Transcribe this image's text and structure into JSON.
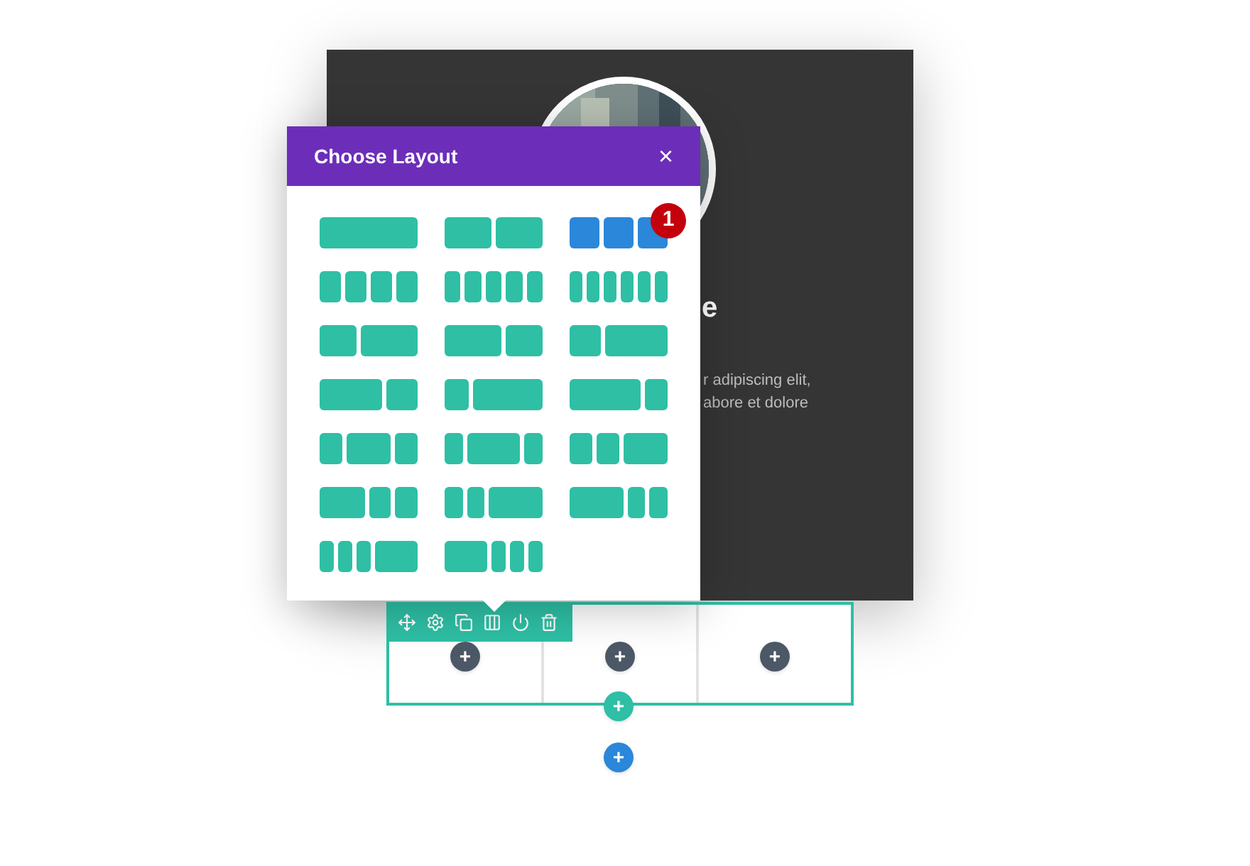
{
  "section": {
    "heading": "e",
    "text_lines": [
      "r adipiscing elit,",
      "abore et dolore"
    ]
  },
  "modal": {
    "title": "Choose Layout",
    "close": "×",
    "badge": "1",
    "layouts": [
      {
        "kind": "full",
        "selected": false
      },
      {
        "kind": "halves",
        "selected": false
      },
      {
        "kind": "thirds",
        "selected": true
      },
      {
        "kind": "quarters",
        "selected": false
      },
      {
        "kind": "fifths",
        "selected": false
      },
      {
        "kind": "sixths",
        "selected": false
      },
      {
        "kind": "two-fifths-three-fifths",
        "selected": false
      },
      {
        "kind": "three-fifths-two-fifths",
        "selected": false
      },
      {
        "kind": "third-two-thirds",
        "selected": false
      },
      {
        "kind": "two-thirds-third",
        "selected": false
      },
      {
        "kind": "quarter-three-quarters",
        "selected": false
      },
      {
        "kind": "three-quarters-quarter",
        "selected": false
      },
      {
        "kind": "quarter-half-quarter",
        "selected": false
      },
      {
        "kind": "fifth-three-fifths-fifth",
        "selected": false
      },
      {
        "kind": "quarter-quarter-half",
        "selected": false
      },
      {
        "kind": "half-quarter-quarter",
        "selected": false
      },
      {
        "kind": "fifth-fifth-three-fifths",
        "selected": false
      },
      {
        "kind": "three-fifths-fifth-fifth",
        "selected": false
      },
      {
        "kind": "sixths-half",
        "selected": false
      },
      {
        "kind": "half-sixths",
        "selected": false
      }
    ]
  },
  "row": {
    "column_add_buttons": [
      "+",
      "+",
      "+"
    ],
    "add_row_button": "+"
  },
  "add_section_button": "+"
}
